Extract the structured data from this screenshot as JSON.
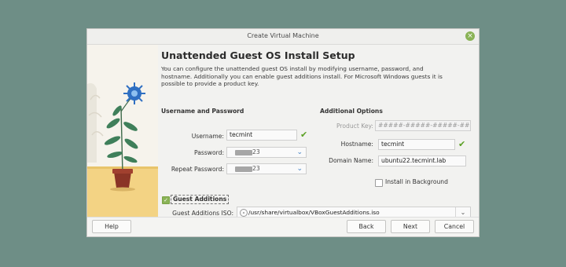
{
  "window": {
    "title": "Create Virtual Machine"
  },
  "page": {
    "heading": "Unattended Guest OS Install Setup",
    "description": "You can configure the unattended guest OS install by modifying username, password, and hostname. Additionally you can enable guest additions install. For Microsoft Windows guests it is possible to provide a product key."
  },
  "user_section": {
    "title": "Username and Password",
    "username_label": "Username:",
    "username_value": "tecmint",
    "password_label": "Password:",
    "password_visible_suffix": "23",
    "repeat_password_label": "Repeat Password:",
    "repeat_password_visible_suffix": "23"
  },
  "additional_section": {
    "title": "Additional Options",
    "product_key_label": "Product Key:",
    "product_key_placeholder": "#####-#####-#####-#####-#",
    "hostname_label": "Hostname:",
    "hostname_value": "tecmint",
    "domain_label": "Domain Name:",
    "domain_value": "ubuntu22.tecmint.lab",
    "install_bg_label": "Install in Background",
    "install_bg_checked": false
  },
  "guest_additions": {
    "label": "Guest Additions",
    "checked": true,
    "iso_label": "Guest Additions ISO:",
    "iso_path": "/usr/share/virtualbox/VBoxGuestAdditions.iso"
  },
  "buttons": {
    "help": "Help",
    "back": "Back",
    "next": "Next",
    "cancel": "Cancel"
  },
  "colors": {
    "background": "#6e8e86",
    "valid_check": "#5aa023",
    "checkbox_checked": "#8ab356"
  }
}
